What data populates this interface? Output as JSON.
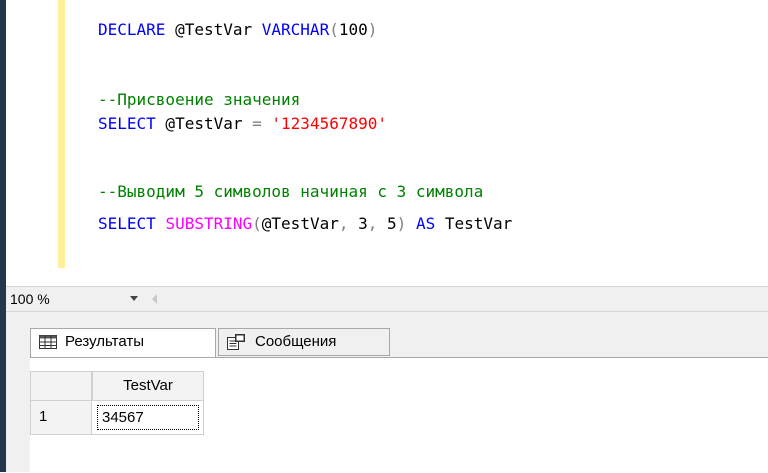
{
  "editor": {
    "lines": [
      {
        "tokens": [
          {
            "text": "DECLARE",
            "cls": "kw"
          },
          {
            "text": " @TestVar ",
            "cls": "txt"
          },
          {
            "text": "VARCHAR",
            "cls": "kw"
          },
          {
            "text": "(",
            "cls": "gray"
          },
          {
            "text": "100",
            "cls": "txt"
          },
          {
            "text": ")",
            "cls": "gray"
          }
        ]
      },
      {
        "tokens": []
      },
      {
        "tokens": [
          {
            "text": "--Присвоение значения",
            "cls": "cmt"
          }
        ]
      },
      {
        "tokens": [
          {
            "text": "SELECT",
            "cls": "kw"
          },
          {
            "text": " @TestVar ",
            "cls": "txt"
          },
          {
            "text": "=",
            "cls": "gray"
          },
          {
            "text": " ",
            "cls": "txt"
          },
          {
            "text": "'1234567890'",
            "cls": "str"
          }
        ]
      },
      {
        "tokens": []
      },
      {
        "tokens": [
          {
            "text": "--Выводим 5 символов начиная с 3 символа",
            "cls": "cmt"
          }
        ]
      },
      {
        "tokens": [
          {
            "text": "SELECT",
            "cls": "kw"
          },
          {
            "text": " ",
            "cls": "txt"
          },
          {
            "text": "SUBSTRING",
            "cls": "fn"
          },
          {
            "text": "(",
            "cls": "gray"
          },
          {
            "text": "@TestVar",
            "cls": "txt"
          },
          {
            "text": ",",
            "cls": "gray"
          },
          {
            "text": " 3",
            "cls": "txt"
          },
          {
            "text": ",",
            "cls": "gray"
          },
          {
            "text": " 5",
            "cls": "txt"
          },
          {
            "text": ")",
            "cls": "gray"
          },
          {
            "text": " ",
            "cls": "txt"
          },
          {
            "text": "AS",
            "cls": "kw"
          },
          {
            "text": " TestVar",
            "cls": "txt"
          }
        ]
      }
    ]
  },
  "zoom": {
    "value": "100 %"
  },
  "tabs": {
    "results_label": "Результаты",
    "messages_label": "Сообщения"
  },
  "grid": {
    "columns": [
      "TestVar"
    ],
    "rows": [
      {
        "num": "1",
        "cells": [
          "34567"
        ]
      }
    ]
  },
  "colors": {
    "keyword": "#0000ff",
    "comment": "#008000",
    "string": "#ff0000",
    "function": "#ff00ff"
  },
  "icons": [
    "grid-icon",
    "messages-icon",
    "dropdown-arrow-icon",
    "scroll-left-icon"
  ]
}
